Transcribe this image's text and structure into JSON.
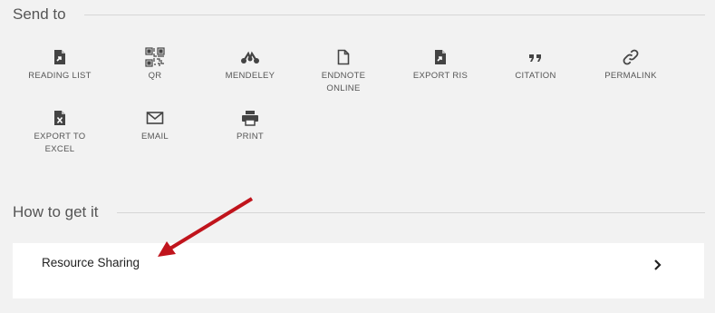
{
  "send_to": {
    "title": "Send to",
    "actions": [
      {
        "label": "READING LIST",
        "icon": "reading-list-icon"
      },
      {
        "label": "QR",
        "icon": "qr-code-icon"
      },
      {
        "label": "MENDELEY",
        "icon": "mendeley-icon"
      },
      {
        "label": "ENDNOTE\nONLINE",
        "icon": "document-icon"
      },
      {
        "label": "EXPORT RIS",
        "icon": "export-file-icon"
      },
      {
        "label": "CITATION",
        "icon": "quote-icon"
      },
      {
        "label": "PERMALINK",
        "icon": "link-icon"
      },
      {
        "label": "EXPORT TO\nEXCEL",
        "icon": "excel-file-icon"
      },
      {
        "label": "EMAIL",
        "icon": "envelope-icon"
      },
      {
        "label": "PRINT",
        "icon": "printer-icon"
      }
    ]
  },
  "how_to_get": {
    "title": "How to get it",
    "option_label": "Resource Sharing"
  },
  "colors": {
    "background": "#f2f2f2",
    "card": "#ffffff",
    "annotation_arrow": "#c0141c",
    "icon": "#444444"
  }
}
